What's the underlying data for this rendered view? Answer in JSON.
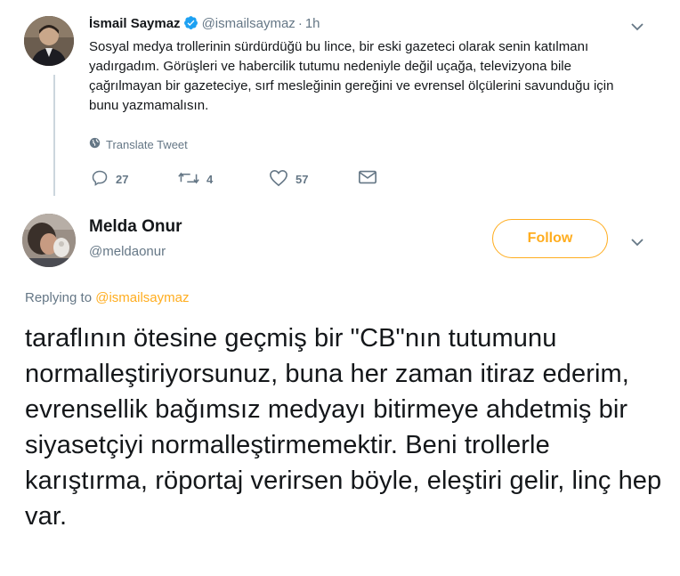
{
  "tweet1": {
    "author_name": "İsmail Saymaz",
    "handle": "@ismailsaymaz",
    "separator": "·",
    "time": "1h",
    "text": "Sosyal medya trollerinin sürdürdüğü bu lince, bir eski gazeteci olarak senin katılmanı yadırgadım. Görüşleri ve habercilik tutumu nedeniyle değil uçağa, televizyona bile çağrılmayan bir gazeteciye, sırf mesleğinin gereğini ve evrensel ölçülerini savunduğu için bunu yazmamalısın.",
    "translate_label": "Translate Tweet",
    "reply_count": "27",
    "retweet_count": "4",
    "like_count": "57"
  },
  "tweet2": {
    "author_name": "Melda Onur",
    "handle": "@meldaonur",
    "follow_label": "Follow",
    "replying_prefix": "Replying to ",
    "replying_to": "@ismailsaymaz",
    "text": "taraflının ötesine geçmiş bir \"CB\"nın tutumunu normalleştiriyorsunuz, buna her zaman itiraz ederim, evrensellik bağımsız medyayı bitirmeye ahdetmiş bir siyasetçiyi normalleştirmemektir. Beni trollerle karıştırma, röportaj verirsen böyle, eleştiri gelir, linç hep var."
  },
  "colors": {
    "accent": "#ffad1f",
    "verified": "#1da1f2",
    "muted": "#657786",
    "text": "#14171a"
  },
  "icons": [
    "verified-badge-icon",
    "chevron-down-icon",
    "globe-icon",
    "reply-icon",
    "retweet-icon",
    "like-icon",
    "direct-message-icon"
  ]
}
